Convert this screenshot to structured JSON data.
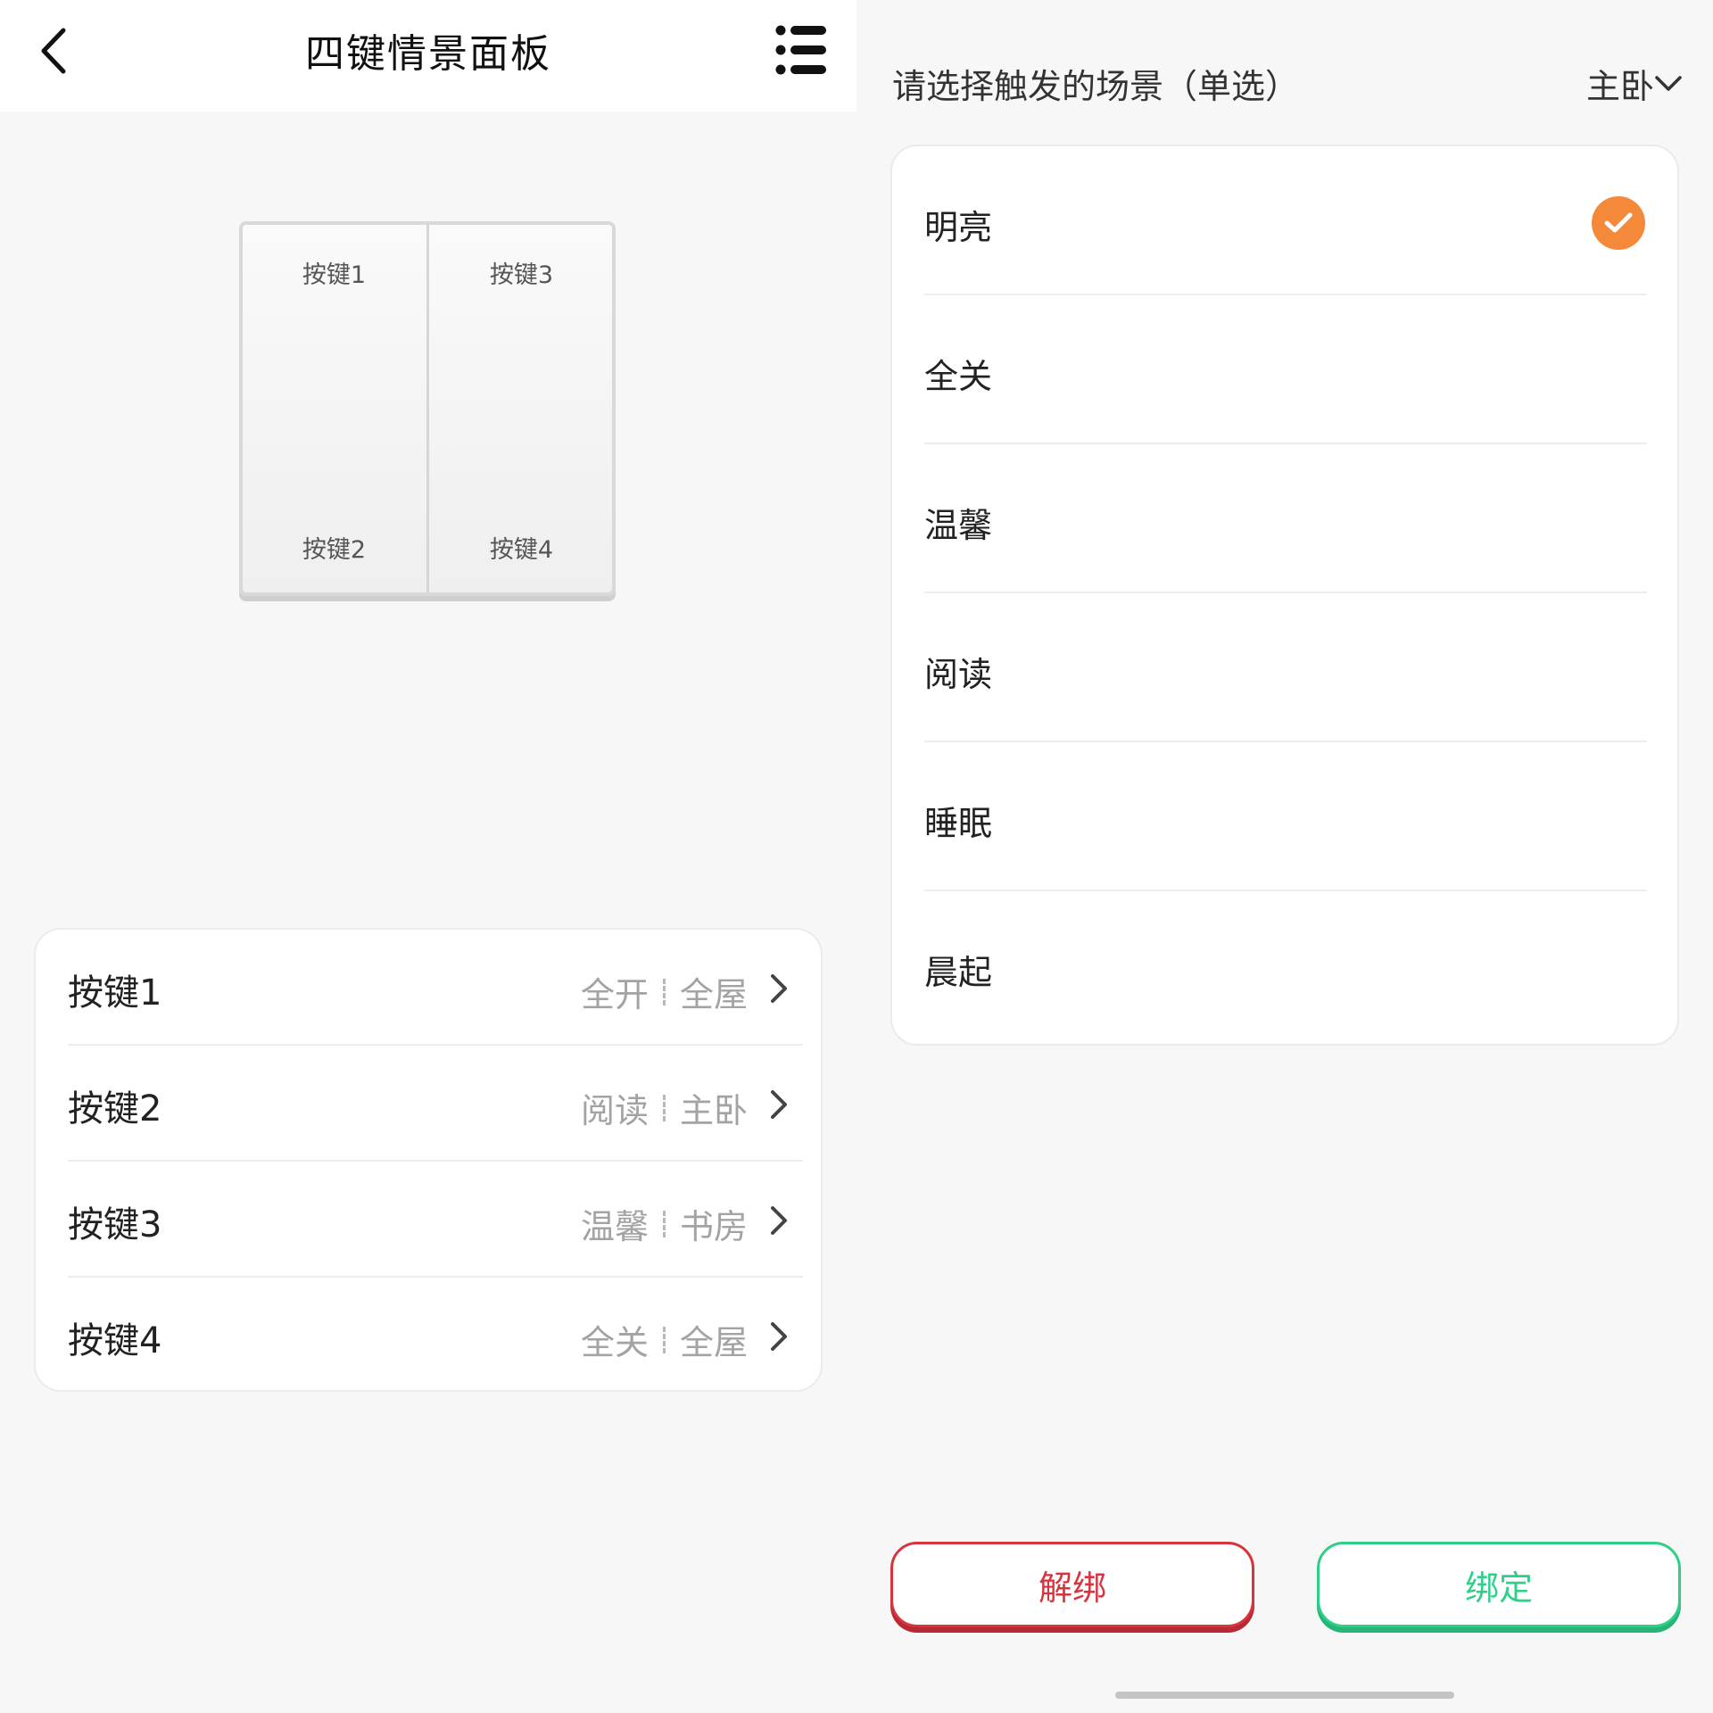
{
  "left": {
    "header": {
      "title": "四键情景面板",
      "back_icon": "chevron-left-icon",
      "menu_icon": "list-icon"
    },
    "panel": {
      "keys": [
        "按键1",
        "按键3",
        "按键2",
        "按键4"
      ]
    },
    "key_list": [
      {
        "label": "按键1",
        "scene": "全开",
        "room": "全屋"
      },
      {
        "label": "按键2",
        "scene": "阅读",
        "room": "主卧"
      },
      {
        "label": "按键3",
        "scene": "温馨",
        "room": "书房"
      },
      {
        "label": "按键4",
        "scene": "全关",
        "room": "全屋"
      }
    ]
  },
  "right": {
    "prompt": "请选择触发的场景（单选）",
    "room_selector": "主卧",
    "scenes": [
      {
        "label": "明亮",
        "selected": true
      },
      {
        "label": "全关",
        "selected": false
      },
      {
        "label": "温馨",
        "selected": false
      },
      {
        "label": "阅读",
        "selected": false
      },
      {
        "label": "睡眠",
        "selected": false
      },
      {
        "label": "晨起",
        "selected": false
      }
    ],
    "buttons": {
      "unbind": "解绑",
      "bind": "绑定"
    }
  },
  "colors": {
    "accent_orange": "#f5893a",
    "unbind_red": "#d8343e",
    "bind_green": "#2fcf8a"
  }
}
